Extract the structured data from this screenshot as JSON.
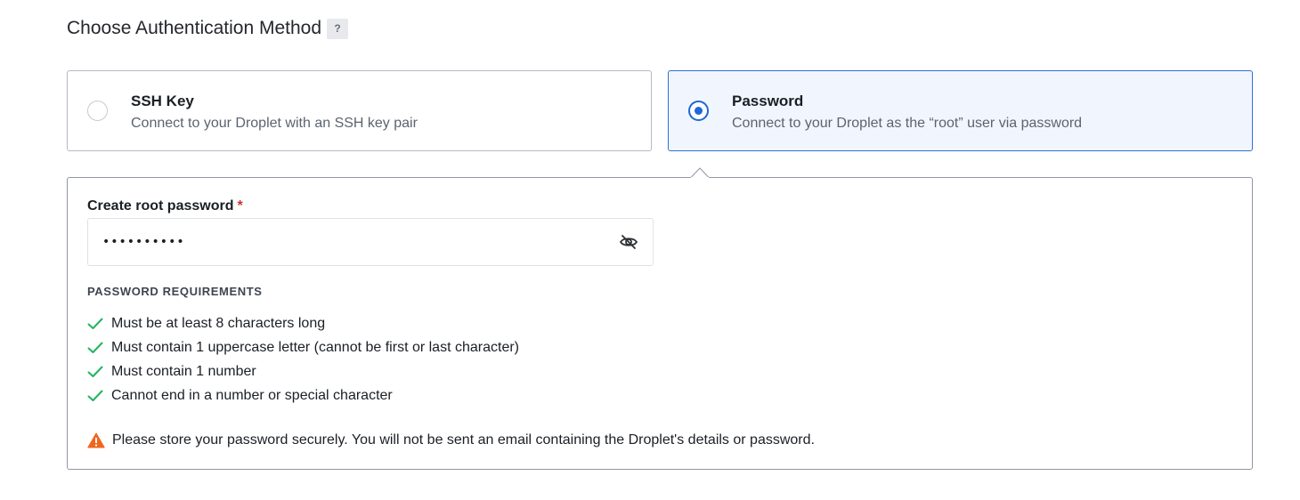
{
  "section": {
    "title": "Choose Authentication Method",
    "help_label": "?"
  },
  "auth_options": {
    "ssh": {
      "title": "SSH Key",
      "description": "Connect to your Droplet with an SSH key pair",
      "selected": false
    },
    "password": {
      "title": "Password",
      "description": "Connect to your Droplet as the “root” user via password",
      "selected": true
    }
  },
  "password_form": {
    "label": "Create root password",
    "required_marker": "*",
    "value": "••••••••••",
    "toggle_visibility_icon": "eye-slash-icon"
  },
  "requirements": {
    "heading": "PASSWORD REQUIREMENTS",
    "items": [
      {
        "text": "Must be at least 8 characters long",
        "met": true
      },
      {
        "text": "Must contain 1 uppercase letter (cannot be first or last character)",
        "met": true
      },
      {
        "text": "Must contain 1 number",
        "met": true
      },
      {
        "text": "Cannot end in a number or special character",
        "met": true
      }
    ]
  },
  "warning": {
    "icon": "warning-triangle-icon",
    "text": "Please store your password securely. You will not be sent an email containing the Droplet's details or password."
  },
  "colors": {
    "accent": "#1f67d8",
    "selected_bg": "#f1f6fe",
    "check_green": "#22b35e",
    "warning_orange": "#f0661e",
    "required_red": "#d0312d"
  }
}
